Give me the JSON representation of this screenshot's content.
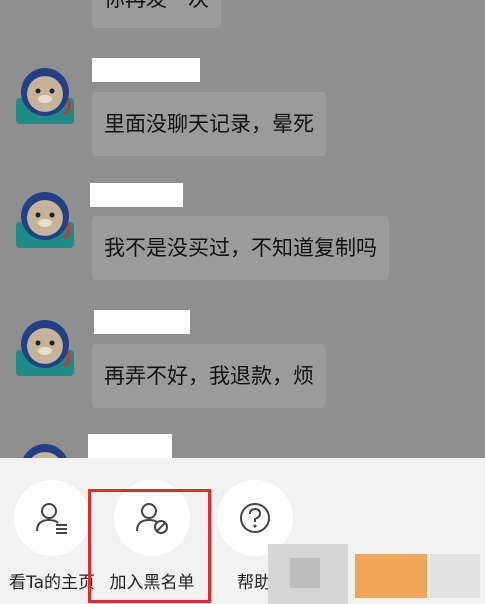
{
  "messages": [
    {
      "text": "你再发一次"
    },
    {
      "text": "里面没聊天记录，晕死"
    },
    {
      "text": "我不是没买过，不知道复制吗"
    },
    {
      "text": "再弄不好，我退款，烦"
    }
  ],
  "actions": [
    {
      "label": "看Ta的主页",
      "icon": "person-list-icon"
    },
    {
      "label": "加入黑名单",
      "icon": "person-block-icon"
    },
    {
      "label": "帮助",
      "icon": "help-icon"
    }
  ],
  "colors": {
    "highlight": "#e02b2b",
    "overlay": "#8f8f8f",
    "sheet": "#f2f2f2"
  }
}
